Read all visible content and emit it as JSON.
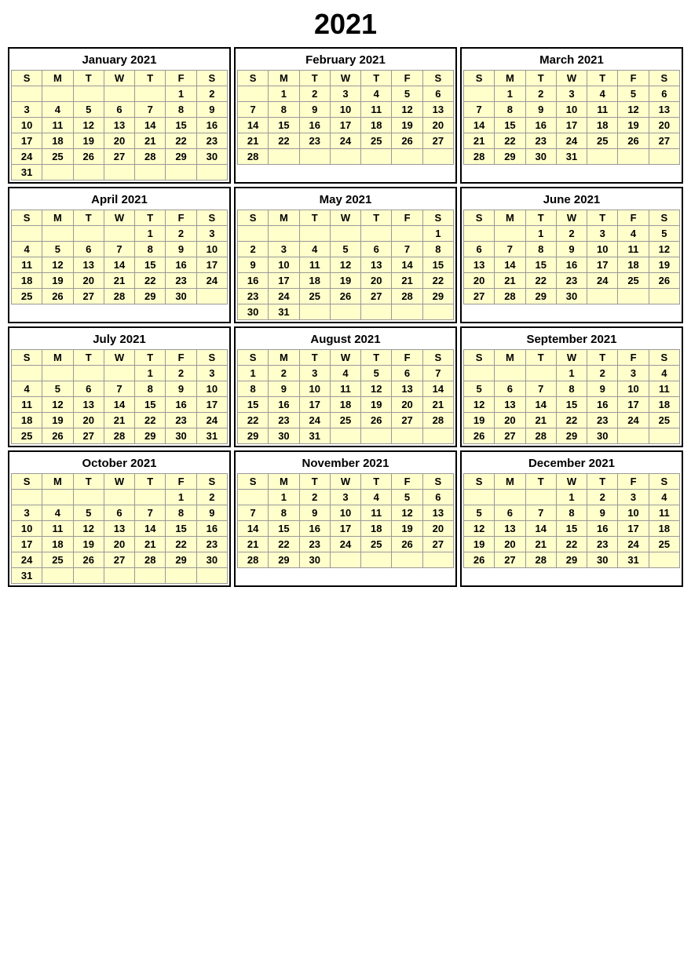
{
  "year": "2021",
  "months": [
    {
      "name": "January 2021",
      "days_header": [
        "S",
        "M",
        "T",
        "W",
        "T",
        "F",
        "S"
      ],
      "weeks": [
        [
          "",
          "",
          "",
          "",
          "",
          "1",
          "2"
        ],
        [
          "3",
          "4",
          "5",
          "6",
          "7",
          "8",
          "9"
        ],
        [
          "10",
          "11",
          "12",
          "13",
          "14",
          "15",
          "16"
        ],
        [
          "17",
          "18",
          "19",
          "20",
          "21",
          "22",
          "23"
        ],
        [
          "24",
          "25",
          "26",
          "27",
          "28",
          "29",
          "30"
        ],
        [
          "31",
          "",
          "",
          "",
          "",
          "",
          ""
        ]
      ]
    },
    {
      "name": "February 2021",
      "days_header": [
        "S",
        "M",
        "T",
        "W",
        "T",
        "F",
        "S"
      ],
      "weeks": [
        [
          "",
          "1",
          "2",
          "3",
          "4",
          "5",
          "6"
        ],
        [
          "7",
          "8",
          "9",
          "10",
          "11",
          "12",
          "13"
        ],
        [
          "14",
          "15",
          "16",
          "17",
          "18",
          "19",
          "20"
        ],
        [
          "21",
          "22",
          "23",
          "24",
          "25",
          "26",
          "27"
        ],
        [
          "28",
          "",
          "",
          "",
          "",
          "",
          ""
        ]
      ]
    },
    {
      "name": "March 2021",
      "days_header": [
        "S",
        "M",
        "T",
        "W",
        "T",
        "F",
        "S"
      ],
      "weeks": [
        [
          "",
          "1",
          "2",
          "3",
          "4",
          "5",
          "6"
        ],
        [
          "7",
          "8",
          "9",
          "10",
          "11",
          "12",
          "13"
        ],
        [
          "14",
          "15",
          "16",
          "17",
          "18",
          "19",
          "20"
        ],
        [
          "21",
          "22",
          "23",
          "24",
          "25",
          "26",
          "27"
        ],
        [
          "28",
          "29",
          "30",
          "31",
          "",
          "",
          ""
        ]
      ]
    },
    {
      "name": "April 2021",
      "days_header": [
        "S",
        "M",
        "T",
        "W",
        "T",
        "F",
        "S"
      ],
      "weeks": [
        [
          "",
          "",
          "",
          "",
          "1",
          "2",
          "3"
        ],
        [
          "4",
          "5",
          "6",
          "7",
          "8",
          "9",
          "10"
        ],
        [
          "11",
          "12",
          "13",
          "14",
          "15",
          "16",
          "17"
        ],
        [
          "18",
          "19",
          "20",
          "21",
          "22",
          "23",
          "24"
        ],
        [
          "25",
          "26",
          "27",
          "28",
          "29",
          "30",
          ""
        ]
      ]
    },
    {
      "name": "May 2021",
      "days_header": [
        "S",
        "M",
        "T",
        "W",
        "T",
        "F",
        "S"
      ],
      "weeks": [
        [
          "",
          "",
          "",
          "",
          "",
          "",
          "1"
        ],
        [
          "2",
          "3",
          "4",
          "5",
          "6",
          "7",
          "8"
        ],
        [
          "9",
          "10",
          "11",
          "12",
          "13",
          "14",
          "15"
        ],
        [
          "16",
          "17",
          "18",
          "19",
          "20",
          "21",
          "22"
        ],
        [
          "23",
          "24",
          "25",
          "26",
          "27",
          "28",
          "29"
        ],
        [
          "30",
          "31",
          "",
          "",
          "",
          "",
          ""
        ]
      ]
    },
    {
      "name": "June 2021",
      "days_header": [
        "S",
        "M",
        "T",
        "W",
        "T",
        "F",
        "S"
      ],
      "weeks": [
        [
          "",
          "",
          "1",
          "2",
          "3",
          "4",
          "5"
        ],
        [
          "6",
          "7",
          "8",
          "9",
          "10",
          "11",
          "12"
        ],
        [
          "13",
          "14",
          "15",
          "16",
          "17",
          "18",
          "19"
        ],
        [
          "20",
          "21",
          "22",
          "23",
          "24",
          "25",
          "26"
        ],
        [
          "27",
          "28",
          "29",
          "30",
          "",
          "",
          ""
        ]
      ]
    },
    {
      "name": "July 2021",
      "days_header": [
        "S",
        "M",
        "T",
        "W",
        "T",
        "F",
        "S"
      ],
      "weeks": [
        [
          "",
          "",
          "",
          "",
          "1",
          "2",
          "3"
        ],
        [
          "4",
          "5",
          "6",
          "7",
          "8",
          "9",
          "10"
        ],
        [
          "11",
          "12",
          "13",
          "14",
          "15",
          "16",
          "17"
        ],
        [
          "18",
          "19",
          "20",
          "21",
          "22",
          "23",
          "24"
        ],
        [
          "25",
          "26",
          "27",
          "28",
          "29",
          "30",
          "31"
        ]
      ]
    },
    {
      "name": "August 2021",
      "days_header": [
        "S",
        "M",
        "T",
        "W",
        "T",
        "F",
        "S"
      ],
      "weeks": [
        [
          "1",
          "2",
          "3",
          "4",
          "5",
          "6",
          "7"
        ],
        [
          "8",
          "9",
          "10",
          "11",
          "12",
          "13",
          "14"
        ],
        [
          "15",
          "16",
          "17",
          "18",
          "19",
          "20",
          "21"
        ],
        [
          "22",
          "23",
          "24",
          "25",
          "26",
          "27",
          "28"
        ],
        [
          "29",
          "30",
          "31",
          "",
          "",
          "",
          ""
        ]
      ]
    },
    {
      "name": "September 2021",
      "days_header": [
        "S",
        "M",
        "T",
        "W",
        "T",
        "F",
        "S"
      ],
      "weeks": [
        [
          "",
          "",
          "",
          "1",
          "2",
          "3",
          "4"
        ],
        [
          "5",
          "6",
          "7",
          "8",
          "9",
          "10",
          "11"
        ],
        [
          "12",
          "13",
          "14",
          "15",
          "16",
          "17",
          "18"
        ],
        [
          "19",
          "20",
          "21",
          "22",
          "23",
          "24",
          "25"
        ],
        [
          "26",
          "27",
          "28",
          "29",
          "30",
          "",
          ""
        ]
      ]
    },
    {
      "name": "October 2021",
      "days_header": [
        "S",
        "M",
        "T",
        "W",
        "T",
        "F",
        "S"
      ],
      "weeks": [
        [
          "",
          "",
          "",
          "",
          "",
          "1",
          "2"
        ],
        [
          "3",
          "4",
          "5",
          "6",
          "7",
          "8",
          "9"
        ],
        [
          "10",
          "11",
          "12",
          "13",
          "14",
          "15",
          "16"
        ],
        [
          "17",
          "18",
          "19",
          "20",
          "21",
          "22",
          "23"
        ],
        [
          "24",
          "25",
          "26",
          "27",
          "28",
          "29",
          "30"
        ],
        [
          "31",
          "",
          "",
          "",
          "",
          "",
          ""
        ]
      ]
    },
    {
      "name": "November 2021",
      "days_header": [
        "S",
        "M",
        "T",
        "W",
        "T",
        "F",
        "S"
      ],
      "weeks": [
        [
          "",
          "1",
          "2",
          "3",
          "4",
          "5",
          "6"
        ],
        [
          "7",
          "8",
          "9",
          "10",
          "11",
          "12",
          "13"
        ],
        [
          "14",
          "15",
          "16",
          "17",
          "18",
          "19",
          "20"
        ],
        [
          "21",
          "22",
          "23",
          "24",
          "25",
          "26",
          "27"
        ],
        [
          "28",
          "29",
          "30",
          "",
          "",
          "",
          ""
        ]
      ]
    },
    {
      "name": "December 2021",
      "days_header": [
        "S",
        "M",
        "T",
        "W",
        "T",
        "F",
        "S"
      ],
      "weeks": [
        [
          "",
          "",
          "",
          "1",
          "2",
          "3",
          "4"
        ],
        [
          "5",
          "6",
          "7",
          "8",
          "9",
          "10",
          "11"
        ],
        [
          "12",
          "13",
          "14",
          "15",
          "16",
          "17",
          "18"
        ],
        [
          "19",
          "20",
          "21",
          "22",
          "23",
          "24",
          "25"
        ],
        [
          "26",
          "27",
          "28",
          "29",
          "30",
          "31",
          ""
        ]
      ]
    }
  ]
}
